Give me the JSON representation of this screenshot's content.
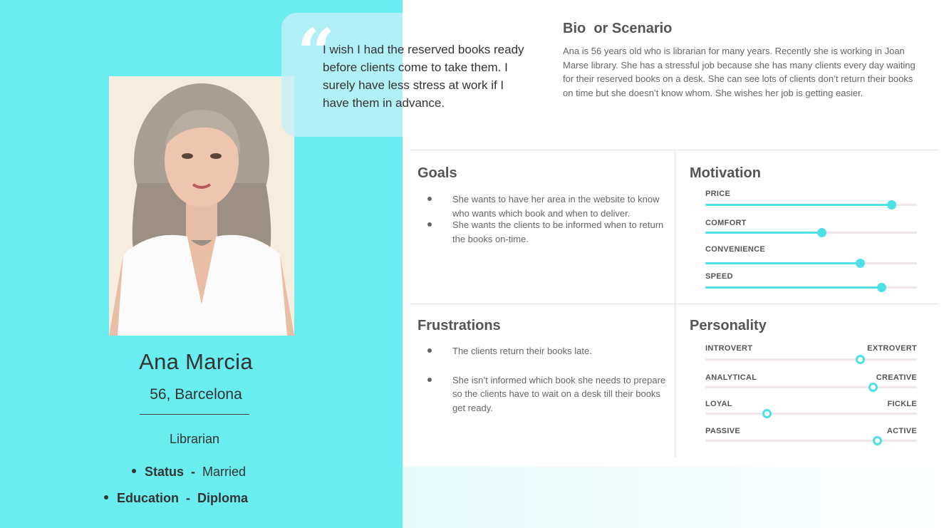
{
  "persona": {
    "name": "Ana Marcia",
    "age_location": "56, Barcelona",
    "occupation": "Librarian",
    "status_label": "Status",
    "status_value": "Married",
    "education_label": "Education",
    "education_value": "Diploma",
    "separator": "-"
  },
  "quote": {
    "open_mark": "“",
    "close_mark": "”",
    "text": "I wish I had the reserved books ready before clients come to take them. I surely have less stress at work if I have them in advance."
  },
  "bio": {
    "title": "Bio  or Scenario",
    "text": "Ana is 56 years old who is librarian for many years. Recently she is working in Joan Marse library. She has a stressful job because she has many clients every day waiting for their reserved books on a desk. She can see lots of clients don’t return their books on time but she doesn’t know whom. She wishes her job is getting easier."
  },
  "goals": {
    "title": "Goals",
    "items": [
      "She wants to have her area in the website to know who wants which book and when to deliver.",
      "She wants the clients to be informed when to return the books on-time."
    ]
  },
  "frustrations": {
    "title": "Frustrations",
    "items": [
      "The clients return their books late.",
      "She isn’t informed which book she needs to prepare so the clients have to wait on a desk till their books get ready."
    ]
  },
  "motivation": {
    "title": "Motivation",
    "items": [
      {
        "label": "PRICE",
        "value": 0.88
      },
      {
        "label": "COMFORT",
        "value": 0.55
      },
      {
        "label": "CONVENIENCE",
        "value": 0.73
      },
      {
        "label": "SPEED",
        "value": 0.83
      }
    ]
  },
  "personality": {
    "title": "Personality",
    "items": [
      {
        "left": "INTROVERT",
        "right": "EXTROVERT",
        "value": 0.73
      },
      {
        "left": "ANALYTICAL",
        "right": "CREATIVE",
        "value": 0.79
      },
      {
        "left": "LOYAL",
        "right": "FICKLE",
        "value": 0.29
      },
      {
        "left": "PASSIVE",
        "right": "ACTIVE",
        "value": 0.81
      }
    ]
  },
  "colors": {
    "accent": "#4fdfe6",
    "panel": "#6aedef",
    "heading": "#555555",
    "body_text": "#666666"
  }
}
